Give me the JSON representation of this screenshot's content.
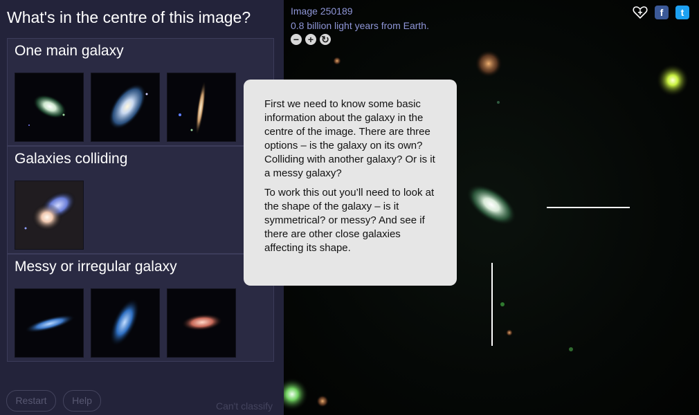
{
  "left_panel": {
    "question": "What's in the centre of this image?",
    "options": [
      {
        "label": "One main galaxy",
        "thumbnails": [
          "smooth-elliptical-galaxy",
          "spiral-galaxy",
          "edge-on-galaxy"
        ]
      },
      {
        "label": "Galaxies colliding",
        "thumbnails": [
          "colliding-galaxies"
        ]
      },
      {
        "label": "Messy or irregular galaxy",
        "thumbnails": [
          "irregular-galaxy-1",
          "irregular-galaxy-2",
          "irregular-galaxy-3"
        ]
      }
    ],
    "buttons": {
      "restart": "Restart",
      "help": "Help",
      "cant_classify": "Can't classify"
    }
  },
  "image_panel": {
    "title": "Image 250189",
    "distance": "0.8 billion light years from Earth.",
    "zoom_controls": {
      "out": "−",
      "in": "+",
      "reset": "↻"
    },
    "social": {
      "favourite_icon": "heart-plus-icon",
      "facebook": "f",
      "twitter": "t"
    }
  },
  "tooltip": {
    "paragraph1": "First we need to know some basic information about the galaxy in the centre of the image. There are three options – is the galaxy on its own? Colliding with another galaxy? Or is it a messy galaxy?",
    "paragraph2": "To work this out you’ll need to look at the shape of the galaxy – is it symmetrical? or messy? And see if there are other close galaxies affecting its shape."
  },
  "colors": {
    "panel_bg": "#23233a",
    "option_bg": "#2a2a43",
    "info_text": "#8f96d8",
    "tooltip_bg": "#e6e6e6"
  }
}
